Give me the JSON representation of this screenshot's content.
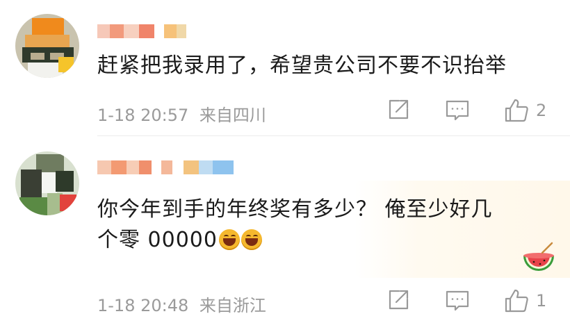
{
  "comments": [
    {
      "text": "赶紧把我录用了，希望贵公司不要不识抬举",
      "time": "1-18 20:57",
      "location": "来自四川",
      "likes": "2"
    },
    {
      "text": "你今年到手的年终奖有多少？ 俺至少好几",
      "text_line2": "个零 00000",
      "time": "1-18 20:48",
      "location": "来自浙江",
      "likes": "1"
    }
  ],
  "icons": {
    "share": "share-icon",
    "comment": "comment-icon",
    "like": "thumbs-up-icon",
    "emoji": "laughing-emoji-icon",
    "sticker": "watermelon-sticker"
  },
  "colors": {
    "text": "#1a1a1a",
    "meta": "#9a9a9a",
    "icon": "#999999",
    "emoji": "#f5b82e"
  }
}
